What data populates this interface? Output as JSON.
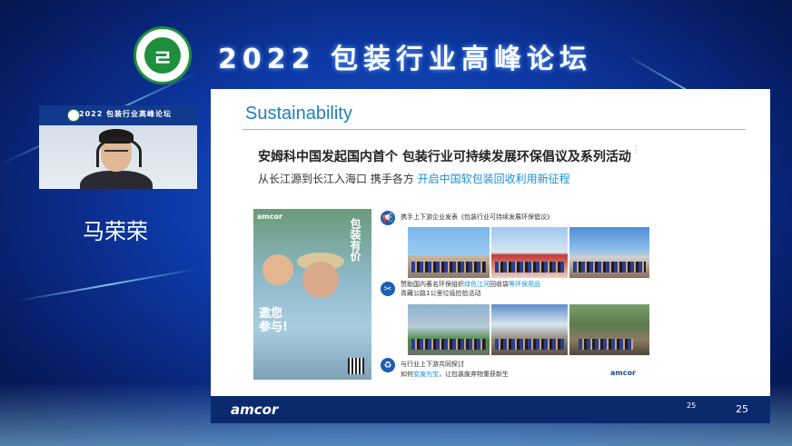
{
  "event_title": "2022 包装行业高峰论坛",
  "speaker_name": "马荣荣",
  "webcam_banner": "2022 包装行业高峰论坛",
  "slide": {
    "title": "Sustainability",
    "headline": "安姆科中国发起国内首个 包装行业可持续发展环保倡议及系列活动",
    "subline_prefix": "从长江源到长江入海口 携手各方",
    "subline_highlight": "开启中国软包装回收利用新征程",
    "poster_brand": "amcor",
    "poster_text_1": "邀您",
    "poster_text_2": "参与!",
    "poster_vertical": "包装有价",
    "items": [
      {
        "icon": "megaphone-icon",
        "text": "携手上下游企业发表《包装行业可持续发展环保倡议》"
      },
      {
        "icon": "tools-icon",
        "text_a": "赞助国内著名环保组织",
        "text_hl": "绿色江河",
        "text_b": "回收袋",
        "text_hl2": "等环保用品",
        "text_c": "青藏公路1公里垃圾捡拾活动"
      },
      {
        "icon": "recycle-icon",
        "text_a": "与行业上下游共同探讨",
        "text_b": "如何",
        "text_hl": "变废为宝",
        "text_c": "，让包装废弃物重获新生"
      }
    ],
    "amcor_small": "amcor",
    "footer_brand": "amcor",
    "page_small": "25",
    "page": "25"
  }
}
